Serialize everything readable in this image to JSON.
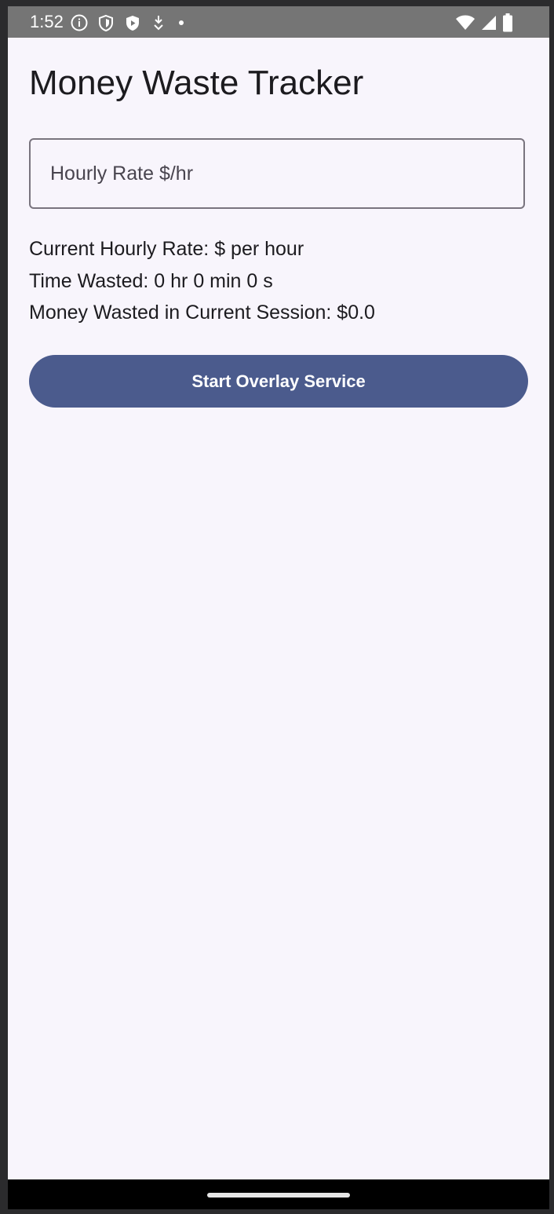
{
  "status_bar": {
    "time": "1:52",
    "icons_left": [
      "info-icon",
      "shield-icon",
      "play-protect-icon",
      "download-icon",
      "dot-icon"
    ],
    "icons_right": [
      "wifi-icon",
      "signal-icon",
      "battery-icon"
    ]
  },
  "app": {
    "title": "Money Waste Tracker"
  },
  "rate_input": {
    "placeholder": "Hourly Rate $/hr",
    "value": ""
  },
  "stats": {
    "current_rate": "Current Hourly Rate: $ per hour",
    "time_wasted": "Time Wasted: 0 hr 0 min 0 s",
    "money_wasted": "Money Wasted in Current Session: $0.0"
  },
  "actions": {
    "start_overlay_label": "Start Overlay Service"
  },
  "colors": {
    "background": "#f8f5fc",
    "primary": "#4b5b8d",
    "outline": "#79747e",
    "status_bar": "#757575",
    "text": "#1c1b1f"
  }
}
